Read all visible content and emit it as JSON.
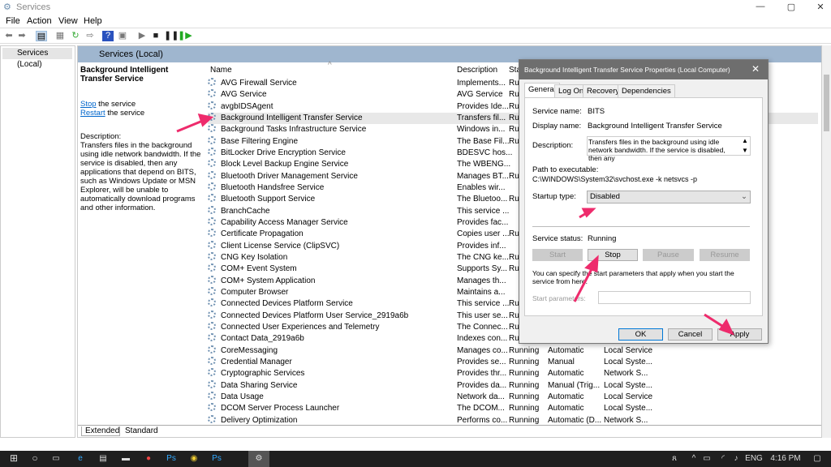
{
  "window": {
    "title": "Services"
  },
  "menu": [
    "File",
    "Action",
    "View",
    "Help"
  ],
  "tree": {
    "root": "Services (Local)"
  },
  "main": {
    "header": "Services (Local)",
    "detail": {
      "title": "Background Intelligent Transfer Service",
      "stop": "Stop",
      "stop_rest": " the service",
      "restart": "Restart",
      "restart_rest": " the service",
      "desc_label": "Description:",
      "desc": "Transfers files in the background using idle network bandwidth. If the service is disabled, then any applications that depend on BITS, such as Windows Update or MSN Explorer, will be unable to automatically download programs and other information."
    },
    "columns": [
      "Name",
      "Description",
      "Sta"
    ],
    "rows": [
      [
        "AVG Firewall Service",
        "Implements...",
        "Ru",
        "",
        ""
      ],
      [
        "AVG Service",
        "AVG Service",
        "Ru",
        "",
        ""
      ],
      [
        "avgbIDSAgent",
        "Provides Ide...",
        "Ru",
        "",
        ""
      ],
      [
        "Background Intelligent Transfer Service",
        "Transfers fil...",
        "Ru",
        "",
        ""
      ],
      [
        "Background Tasks Infrastructure Service",
        "Windows in...",
        "Ru",
        "",
        ""
      ],
      [
        "Base Filtering Engine",
        "The Base Fil...",
        "Ru",
        "",
        ""
      ],
      [
        "BitLocker Drive Encryption Service",
        "BDESVC hos...",
        "",
        "",
        ""
      ],
      [
        "Block Level Backup Engine Service",
        "The WBENG...",
        "",
        "",
        ""
      ],
      [
        "Bluetooth Driver Management Service",
        "Manages BT...",
        "Ru",
        "",
        ""
      ],
      [
        "Bluetooth Handsfree Service",
        "Enables wir...",
        "",
        "",
        ""
      ],
      [
        "Bluetooth Support Service",
        "The Bluetoo...",
        "Ru",
        "",
        ""
      ],
      [
        "BranchCache",
        "This service ...",
        "",
        "",
        ""
      ],
      [
        "Capability Access Manager Service",
        "Provides fac...",
        "",
        "",
        ""
      ],
      [
        "Certificate Propagation",
        "Copies user ...",
        "Ru",
        "",
        ""
      ],
      [
        "Client License Service (ClipSVC)",
        "Provides inf...",
        "",
        "",
        ""
      ],
      [
        "CNG Key Isolation",
        "The CNG ke...",
        "Ru",
        "",
        ""
      ],
      [
        "COM+ Event System",
        "Supports Sy...",
        "Ru",
        "",
        ""
      ],
      [
        "COM+ System Application",
        "Manages th...",
        "",
        "",
        ""
      ],
      [
        "Computer Browser",
        "Maintains a...",
        "",
        "",
        ""
      ],
      [
        "Connected Devices Platform Service",
        "This service ...",
        "Ru",
        "",
        ""
      ],
      [
        "Connected Devices Platform User Service_2919a6b",
        "This user se...",
        "Ru",
        "",
        ""
      ],
      [
        "Connected User Experiences and Telemetry",
        "The Connec...",
        "Ru",
        "",
        ""
      ],
      [
        "Contact Data_2919a6b",
        "Indexes con...",
        "Ru",
        "",
        ""
      ],
      [
        "CoreMessaging",
        "Manages co...",
        "Running",
        "Automatic",
        "Local Service"
      ],
      [
        "Credential Manager",
        "Provides se...",
        "Running",
        "Manual",
        "Local Syste..."
      ],
      [
        "Cryptographic Services",
        "Provides thr...",
        "Running",
        "Automatic",
        "Network S..."
      ],
      [
        "Data Sharing Service",
        "Provides da...",
        "Running",
        "Manual (Trig...",
        "Local Syste..."
      ],
      [
        "Data Usage",
        "Network da...",
        "Running",
        "Automatic",
        "Local Service"
      ],
      [
        "DCOM Server Process Launcher",
        "The DCOM...",
        "Running",
        "Automatic",
        "Local Syste..."
      ],
      [
        "Delivery Optimization",
        "Performs co...",
        "Running",
        "Automatic (D...",
        "Network S..."
      ]
    ],
    "tabs": [
      "Extended",
      "Standard"
    ]
  },
  "dialog": {
    "title": "Background Intelligent Transfer Service Properties (Local Computer)",
    "tabs": [
      "General",
      "Log On",
      "Recovery",
      "Dependencies"
    ],
    "service_name_label": "Service name:",
    "service_name": "BITS",
    "display_name_label": "Display name:",
    "display_name": "Background Intelligent Transfer Service",
    "description_label": "Description:",
    "description": "Transfers files in the background using idle network bandwidth. If the service is disabled, then any",
    "path_label": "Path to executable:",
    "path": "C:\\WINDOWS\\System32\\svchost.exe -k netsvcs -p",
    "startup_label": "Startup type:",
    "startup": "Disabled",
    "status_label": "Service status:",
    "status": "Running",
    "start": "Start",
    "stop": "Stop",
    "pause": "Pause",
    "resume": "Resume",
    "hint": "You can specify the start parameters that apply when you start the service from here.",
    "params_label": "Start parameters:",
    "params_value": "",
    "ok": "OK",
    "cancel": "Cancel",
    "apply": "Apply"
  },
  "taskbar": {
    "lang": "ENG",
    "time": "4:16 PM"
  },
  "colors": {
    "header": "#9fb6cf",
    "dialog_title": "#6e6e6e",
    "arrow": "#ee2b6c",
    "taskbar": "#1f1f1f"
  }
}
